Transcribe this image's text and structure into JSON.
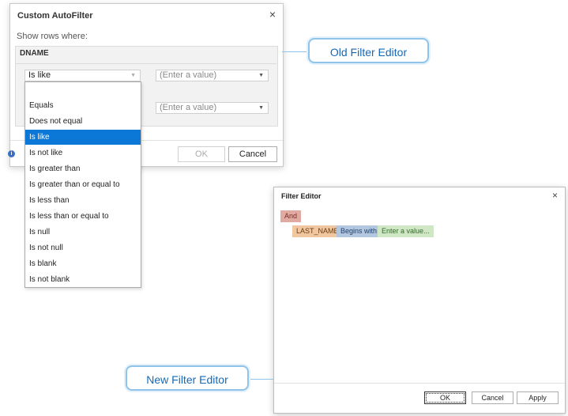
{
  "old_dialog": {
    "title": "Custom AutoFilter",
    "close_glyph": "×",
    "show_rows_label": "Show rows where:",
    "field_name": "DNAME",
    "operator_value": "Is like",
    "value_placeholder_1": "(Enter a value)",
    "value_placeholder_2": "(Enter a value)",
    "ok_label": "OK",
    "cancel_label": "Cancel",
    "info_icon": "info-icon"
  },
  "dropdown": {
    "items": [
      {
        "label": "Equals"
      },
      {
        "label": "Does not equal"
      },
      {
        "label": "Is like"
      },
      {
        "label": "Is not like"
      },
      {
        "label": "Is greater than"
      },
      {
        "label": "Is greater than or equal to"
      },
      {
        "label": "Is less than"
      },
      {
        "label": "Is less than or equal to"
      },
      {
        "label": "Is null"
      },
      {
        "label": "Is not null"
      },
      {
        "label": "Is blank"
      },
      {
        "label": "Is not blank"
      }
    ],
    "selected_index": 2
  },
  "callouts": {
    "old_label": "Old Filter Editor",
    "new_label": "New Filter Editor"
  },
  "new_dialog": {
    "title": "Filter Editor",
    "close_glyph": "×",
    "group_operator": "And",
    "condition": {
      "field": "LAST_NAME",
      "operator": "Begins with",
      "value": "Enter a value..."
    },
    "ok_label": "OK",
    "cancel_label": "Cancel",
    "apply_label": "Apply"
  },
  "colors": {
    "accent": "#0b78d7",
    "callout_border": "#8fc3ea",
    "callout_text": "#1569b8"
  }
}
